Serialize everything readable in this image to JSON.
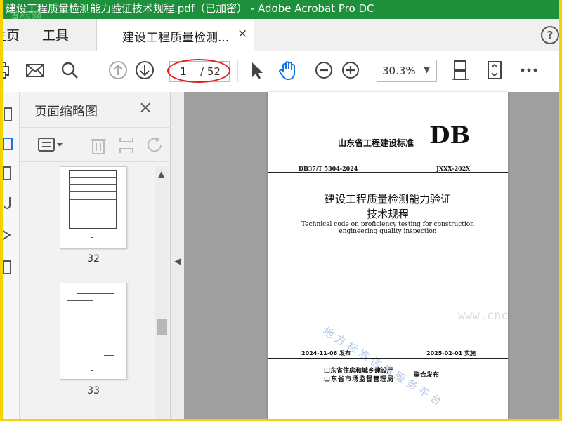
{
  "window": {
    "title": "建设工程质量检测能力验证技术规程.pdf（已加密） - Adobe Acrobat Pro DC",
    "watermark_logo": "道标网"
  },
  "tabs": {
    "home": "主页",
    "tools": "工具",
    "document": "建设工程质量检测...",
    "close": "×",
    "help": "?"
  },
  "toolbar": {
    "icons": [
      "print-icon",
      "mail-icon",
      "search-icon",
      "prev-page-icon",
      "next-page-icon",
      "select-arrow-icon",
      "hand-icon",
      "zoom-out-icon",
      "zoom-in-icon",
      "scroll-mode-icon",
      "fit-page-icon",
      "more-icon"
    ],
    "current_page": "1",
    "total_pages": "/ 52",
    "zoom": "30.3%",
    "highlight_color": "#e0201f"
  },
  "sidebar": {
    "title": "页面缩略图",
    "close": "×",
    "thumbnails": [
      {
        "page": "32"
      },
      {
        "page": "33"
      }
    ]
  },
  "document_page": {
    "issuer": "山东省工程建设标准",
    "mark": "DB",
    "code": "DB37/T 5304-2024",
    "replaces": "JXXX-202X",
    "title_line1": "建设工程质量检测能力验证",
    "title_line2": "技术规程",
    "english_line1": "Technical code on proficiency testing for construction",
    "english_line2": "engineering quality inspection",
    "publish_date": "2024-11-06  发布",
    "effective_date": "2025-02-01  实施",
    "org1": "山东省住房和城乡建设厅",
    "org2": "山东省市场监督管理局",
    "joint": "联合发布",
    "watermark": "地方标准信息服务平台"
  },
  "site_watermark": "www.cnc",
  "colors": {
    "titlebar": "#1e8f3a",
    "frame": "#f3d400",
    "accent": "#1473e6"
  }
}
